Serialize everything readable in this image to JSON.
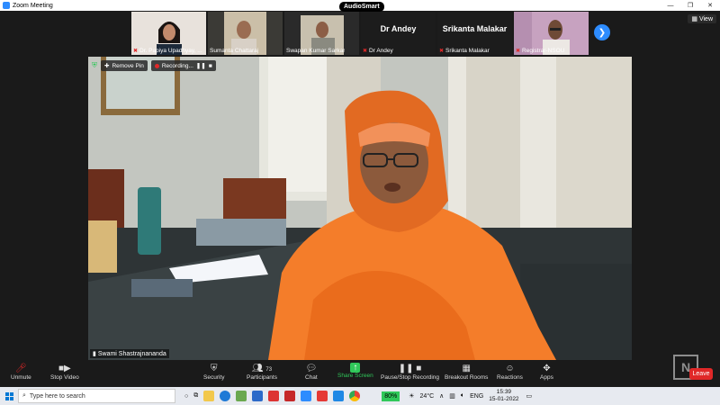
{
  "window": {
    "title": "Zoom Meeting",
    "minimize": "—",
    "maximize": "❐",
    "close": "✕"
  },
  "audiosmart": "AudioSmart",
  "view_label": "View",
  "thumbnails": [
    {
      "name": "Dr. Papiya Upadhyay, ...",
      "type": "video"
    },
    {
      "name": "Sumanta Chattaraj",
      "type": "video"
    },
    {
      "name": "Swapan Kumar Sarkar",
      "type": "video"
    },
    {
      "name": "Dr Andey",
      "big": "Dr Andey",
      "type": "text"
    },
    {
      "name": "Srikanta Malakar",
      "big": "Srikanta Malakar",
      "type": "text"
    },
    {
      "name": "Registrar-NSOU",
      "type": "video"
    }
  ],
  "main": {
    "remove_pin": "Remove Pin",
    "recording": "Recording...",
    "speaker": "Swami Shastrajnananda"
  },
  "controls": {
    "unmute": "Unmute",
    "stop_video": "Stop Video",
    "security": "Security",
    "participants": "Participants",
    "participant_count": "73",
    "chat": "Chat",
    "share_screen": "Share Screen",
    "pause_recording": "Pause/Stop Recording",
    "breakout": "Breakout Rooms",
    "reactions": "Reactions",
    "apps": "Apps",
    "leave": "Leave"
  },
  "taskbar": {
    "search_placeholder": "Type here to search",
    "battery": "80%",
    "temperature": "24°C",
    "language": "ENG",
    "time": "15:39",
    "date": "15-01-2022"
  },
  "colors": {
    "accent": "#2d8cff",
    "danger": "#e02828",
    "green": "#30c85a"
  }
}
